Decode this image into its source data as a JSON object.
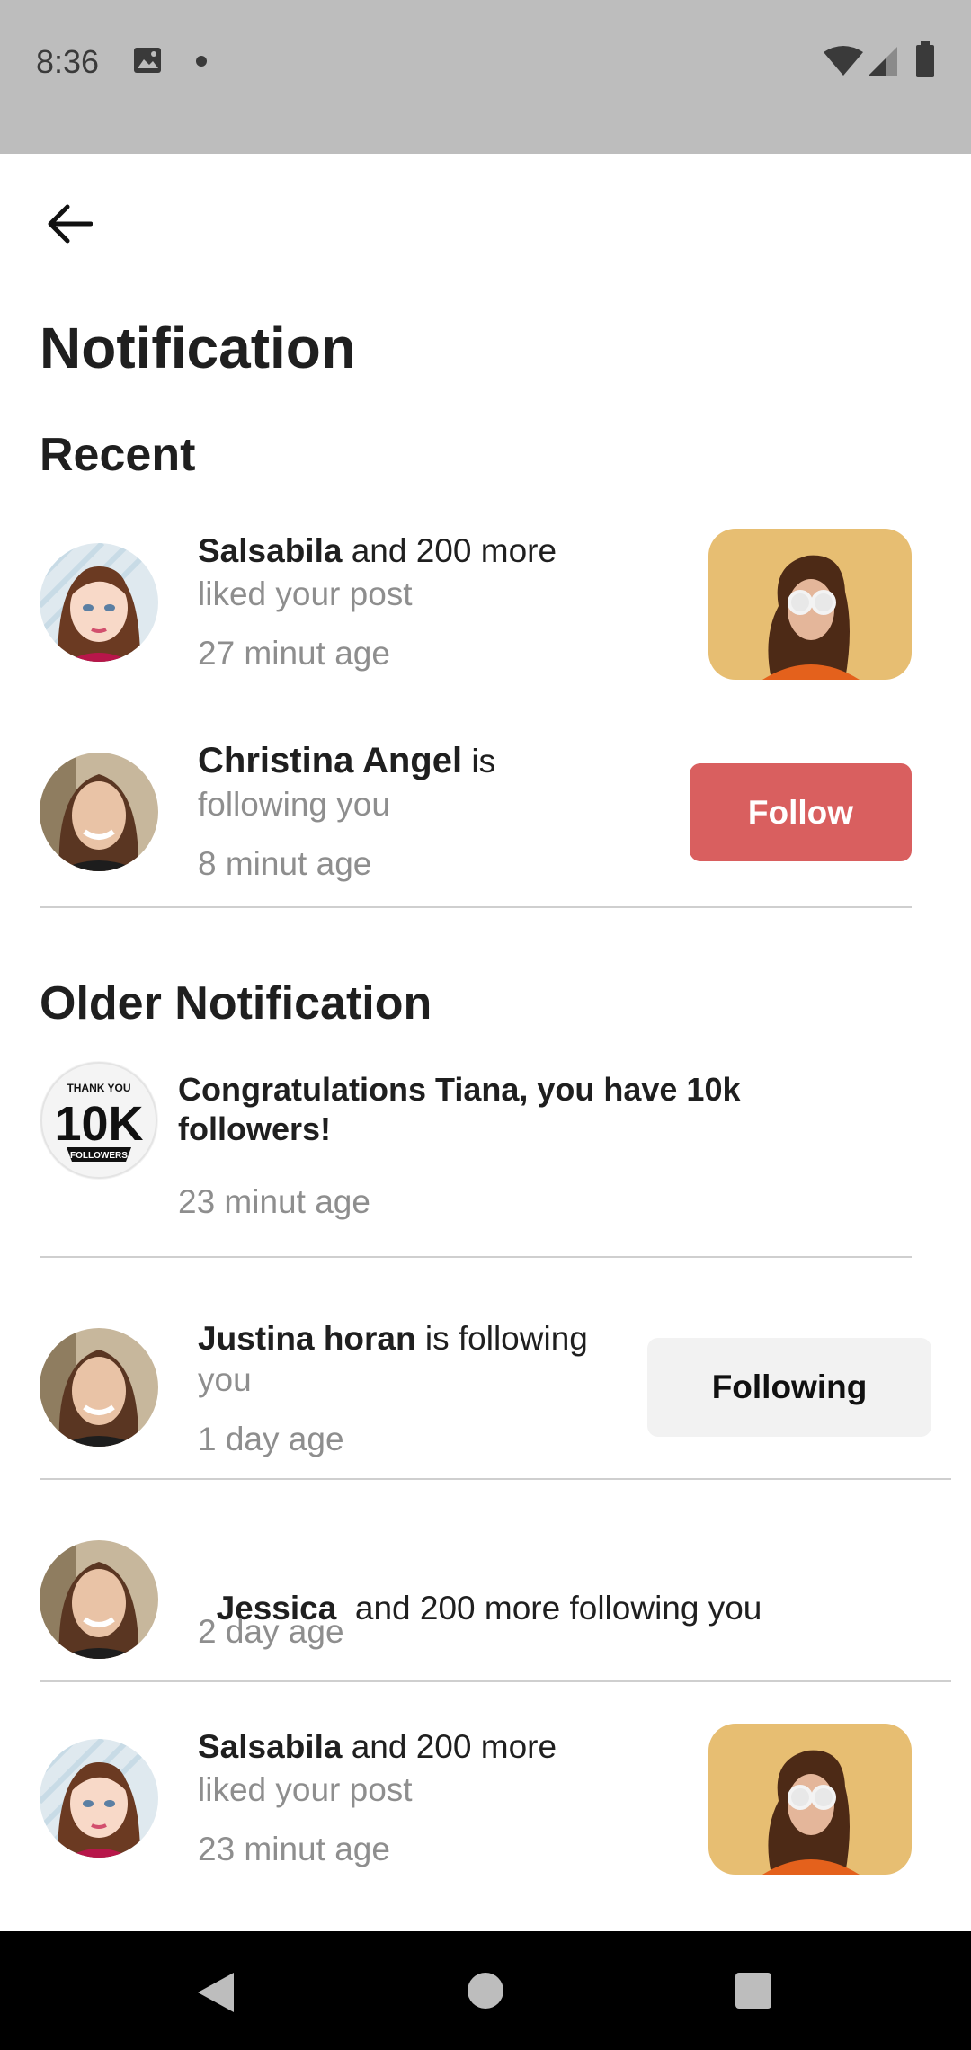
{
  "status_bar": {
    "time": "8:36"
  },
  "header": {
    "title": "Notification"
  },
  "recent": {
    "heading": "Recent",
    "items": [
      {
        "name": "Salsabila",
        "rest": " and 200 more",
        "line2": "liked your post",
        "time": "27 minut age"
      },
      {
        "name": "Christina Angel",
        "rest": " is",
        "line2": "following you",
        "time": "8 minut age",
        "button": "Follow"
      }
    ]
  },
  "older": {
    "heading": "Older Notification",
    "badge": {
      "top": "THANK YOU",
      "big": "10K",
      "bottom": "FOLLOWERS"
    },
    "congrats": {
      "text": "Congratulations Tiana, you have 10k followers!",
      "time": "23 minut age"
    },
    "items": [
      {
        "name": "Justina horan",
        "rest": " is following",
        "line2": "you",
        "time": "1 day age",
        "button": "Following"
      },
      {
        "name": "Jessica",
        "rest": "  and 200 more following you",
        "time": "2 day age"
      },
      {
        "name": "Salsabila",
        "rest": " and 200 more",
        "line2": "liked your post",
        "time": "23 minut age"
      }
    ]
  },
  "colors": {
    "follow_button": "#d95f5f",
    "following_button": "#f2f2f2",
    "status_bar": "#bdbdbd"
  }
}
